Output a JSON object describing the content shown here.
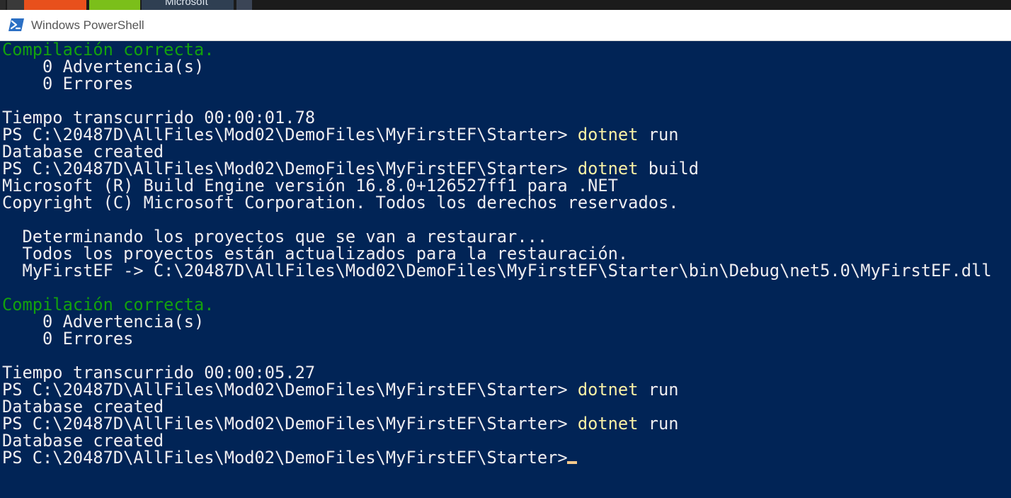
{
  "window": {
    "title": "Windows PowerShell",
    "background_partial_label": "Microsoft",
    "icon": "powershell-icon"
  },
  "colors": {
    "console_bg": "#012456",
    "text": "#eeedf0",
    "success": "#13a10e",
    "command": "#f9f1a5",
    "cursor": "#f7c98b"
  },
  "console": {
    "lines": [
      {
        "type": "success",
        "text": "Compilación correcta."
      },
      {
        "type": "output",
        "text": "    0 Advertencia(s)"
      },
      {
        "type": "output",
        "text": "    0 Errores"
      },
      {
        "type": "blank",
        "text": ""
      },
      {
        "type": "output",
        "text": "Tiempo transcurrido 00:00:01.78"
      },
      {
        "type": "prompt",
        "prompt": "PS C:\\20487D\\AllFiles\\Mod02\\DemoFiles\\MyFirstEF\\Starter> ",
        "command": "dotnet",
        "args": " run"
      },
      {
        "type": "output",
        "text": "Database created"
      },
      {
        "type": "prompt",
        "prompt": "PS C:\\20487D\\AllFiles\\Mod02\\DemoFiles\\MyFirstEF\\Starter> ",
        "command": "dotnet",
        "args": " build"
      },
      {
        "type": "output",
        "text": "Microsoft (R) Build Engine versión 16.8.0+126527ff1 para .NET"
      },
      {
        "type": "output",
        "text": "Copyright (C) Microsoft Corporation. Todos los derechos reservados."
      },
      {
        "type": "blank",
        "text": ""
      },
      {
        "type": "output",
        "text": "  Determinando los proyectos que se van a restaurar..."
      },
      {
        "type": "output",
        "text": "  Todos los proyectos están actualizados para la restauración."
      },
      {
        "type": "output",
        "text": "  MyFirstEF -> C:\\20487D\\AllFiles\\Mod02\\DemoFiles\\MyFirstEF\\Starter\\bin\\Debug\\net5.0\\MyFirstEF.dll"
      },
      {
        "type": "blank",
        "text": ""
      },
      {
        "type": "success",
        "text": "Compilación correcta."
      },
      {
        "type": "output",
        "text": "    0 Advertencia(s)"
      },
      {
        "type": "output",
        "text": "    0 Errores"
      },
      {
        "type": "blank",
        "text": ""
      },
      {
        "type": "output",
        "text": "Tiempo transcurrido 00:00:05.27"
      },
      {
        "type": "prompt",
        "prompt": "PS C:\\20487D\\AllFiles\\Mod02\\DemoFiles\\MyFirstEF\\Starter> ",
        "command": "dotnet",
        "args": " run"
      },
      {
        "type": "output",
        "text": "Database created"
      },
      {
        "type": "prompt",
        "prompt": "PS C:\\20487D\\AllFiles\\Mod02\\DemoFiles\\MyFirstEF\\Starter> ",
        "command": "dotnet",
        "args": " run"
      },
      {
        "type": "output",
        "text": "Database created"
      },
      {
        "type": "prompt",
        "prompt": "PS C:\\20487D\\AllFiles\\Mod02\\DemoFiles\\MyFirstEF\\Starter> ",
        "command": "",
        "args": ""
      }
    ]
  }
}
